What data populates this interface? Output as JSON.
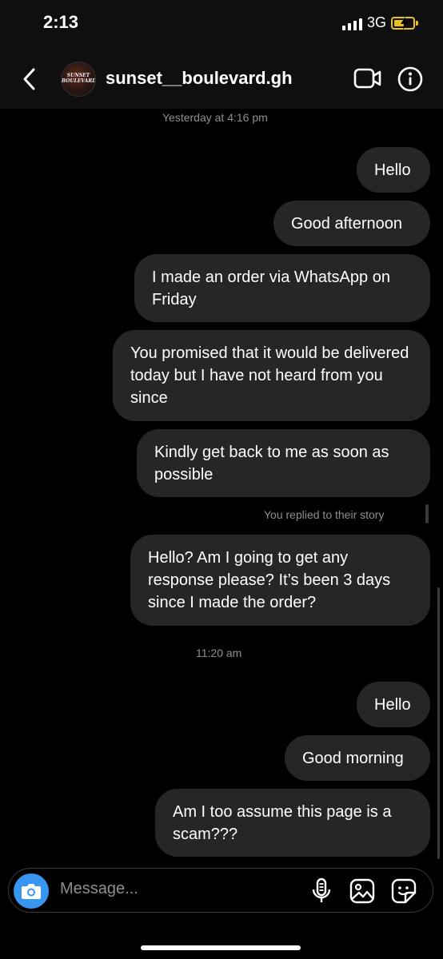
{
  "status": {
    "time": "2:13",
    "network": "3G"
  },
  "header": {
    "username": "sunset__boulevard.gh",
    "avatar_text": "SUNSET BOULEVARD"
  },
  "timestamps": {
    "first": "Yesterday at 4:16 pm",
    "second": "11:20 am"
  },
  "messages": [
    "Hello",
    "Good afternoon",
    "I made an order via WhatsApp on Friday",
    "You promised that it would be delivered today but I have not heard from you since",
    "Kindly get back to me as soon as possible",
    "Hello? Am I going to get any response please? It’s been 3 days since I made the order?",
    "Hello",
    "Good morning",
    "Am I too assume this page is a scam???"
  ],
  "story_reply": "You replied to their story",
  "composer": {
    "placeholder": "Message..."
  },
  "colors": {
    "bubble": "#262626",
    "camera": "#3797f0",
    "battery": "#e8c21b"
  },
  "icons": [
    "back-icon",
    "video-call-icon",
    "info-icon",
    "camera-icon",
    "microphone-icon",
    "gallery-icon",
    "sticker-icon"
  ]
}
